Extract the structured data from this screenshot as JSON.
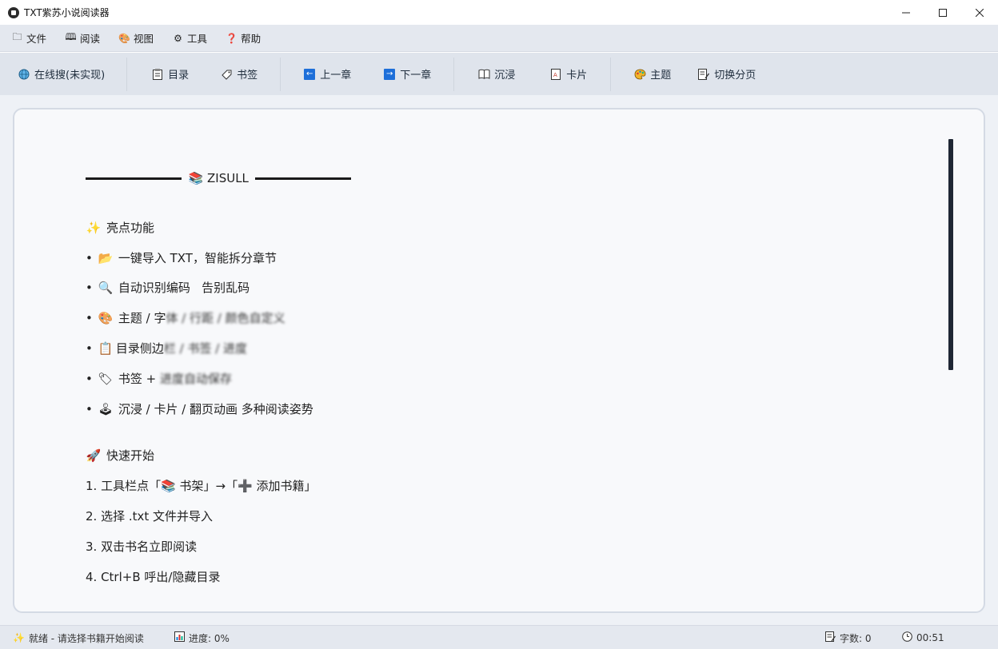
{
  "window": {
    "title": "TXT紫苏小说阅读器"
  },
  "menu": [
    {
      "icon": "folder-icon",
      "glyph": "🗀",
      "label": "文件"
    },
    {
      "icon": "book-icon",
      "glyph": "🕮",
      "label": "阅读"
    },
    {
      "icon": "palette-icon",
      "glyph": "🎨",
      "label": "视图"
    },
    {
      "icon": "gear-icon",
      "glyph": "⚙",
      "label": "工具"
    },
    {
      "icon": "question-icon",
      "glyph": "❓",
      "label": "帮助"
    }
  ],
  "toolbar": {
    "online_search": "在线搜(未实现)",
    "toc": "目录",
    "bookmark": "书签",
    "prev_chapter": "上一章",
    "next_chapter": "下一章",
    "immersive": "沉浸",
    "card": "卡片",
    "theme": "主题",
    "page_mode": "切换分页"
  },
  "content": {
    "heading": "ZISULL",
    "features_title": "亮点功能",
    "features": [
      {
        "bullet": "•",
        "emoji": "📂",
        "text": "一键导入 TXT，智能拆分章节"
      },
      {
        "bullet": "•",
        "emoji": "🔍",
        "text": "自动识别编码   告别乱码"
      },
      {
        "bullet": "•",
        "emoji": "🎨",
        "text": "主题 / 字",
        "blurred": "体 / 行距 / 颜色自定义"
      },
      {
        "bullet": "•",
        "emoji": "📋",
        "text": "目录侧边",
        "blurred": "栏 / 书签 / 进度"
      },
      {
        "bullet": "•",
        "emoji": "🏷",
        "text": "书签 + ",
        "blurred": "进度自动保存"
      },
      {
        "bullet": "•",
        "emoji": "🕹",
        "text": "沉浸 / 卡片 / 翻页动画 多种阅读姿势"
      }
    ],
    "quickstart_title": "快速开始",
    "steps": [
      "1. 工具栏点「📚 书架」→「➕ 添加书籍」",
      "2. 选择 .txt 文件并导入",
      "3. 双击书名立即阅读",
      "4. Ctrl+B 呼出/隐藏目录"
    ]
  },
  "status": {
    "ready": "就绪 - 请选择书籍开始阅读",
    "progress": "进度: 0%",
    "word_count": "字数: 0",
    "time": "00:51"
  }
}
